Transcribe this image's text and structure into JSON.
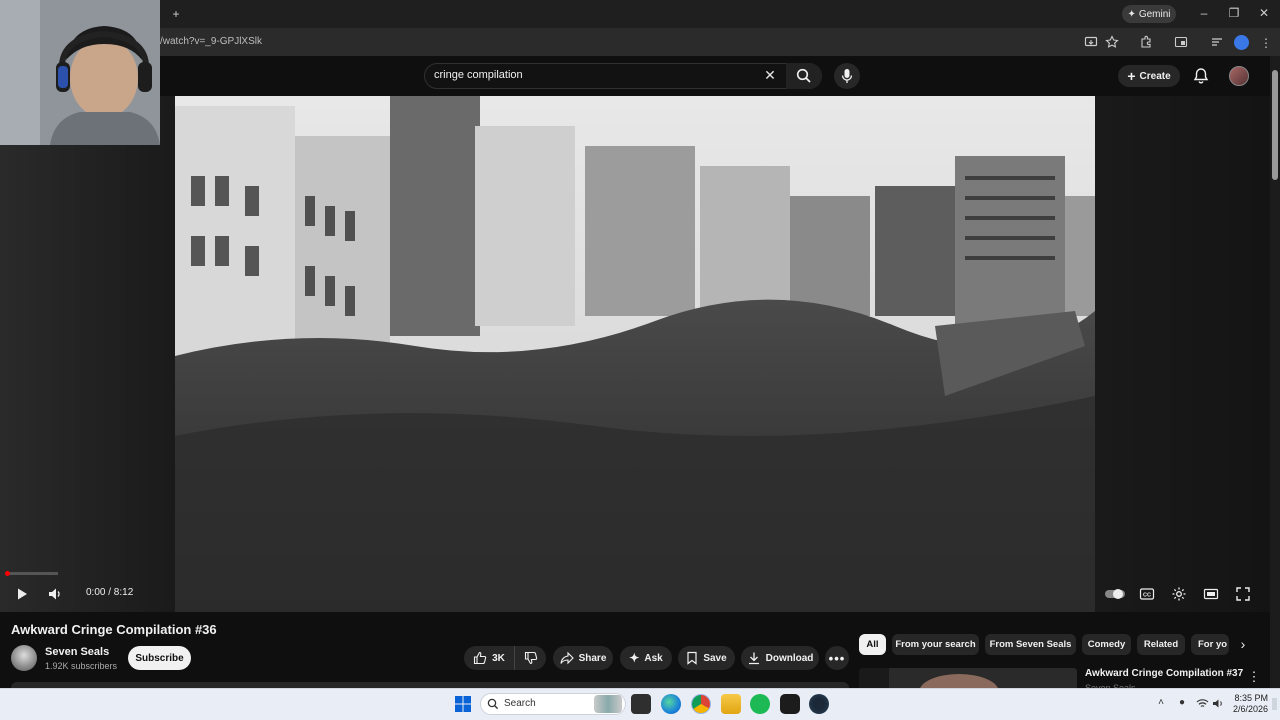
{
  "browser": {
    "new_tab_glyph": "+",
    "url": "/watch?v=_9-GPJlXSlk",
    "gemini_label": "Gemini",
    "window_controls": [
      "–",
      "❐",
      "✕"
    ]
  },
  "header": {
    "search_query": "cringe compilation",
    "create_label": "Create"
  },
  "player": {
    "time": "0:00 / 8:12",
    "progress_buffered_fraction": 0.11,
    "progress_played_fraction": 0.0
  },
  "video": {
    "title": "Awkward Cringe Compilation #36",
    "channel": "Seven Seals",
    "subscribers": "1.92K subscribers",
    "subscribe_label": "Subscribe",
    "like_count": "3K",
    "share_label": "Share",
    "ask_label": "Ask",
    "save_label": "Save",
    "download_label": "Download"
  },
  "chips": [
    "All",
    "From your search",
    "From Seven Seals",
    "Comedy",
    "Related",
    "For yo"
  ],
  "recommendation": {
    "title": "Awkward Cringe Compilation #37",
    "channel": "Seven Seals"
  },
  "taskbar": {
    "search_placeholder": "Search",
    "time": "8:35 PM",
    "date": "2/6/2026"
  },
  "colors": {
    "accent_red": "#ff0000",
    "yt_background": "#0f0f0f",
    "pill_bg": "#272727",
    "taskbar_bg": "#e9eef6"
  }
}
